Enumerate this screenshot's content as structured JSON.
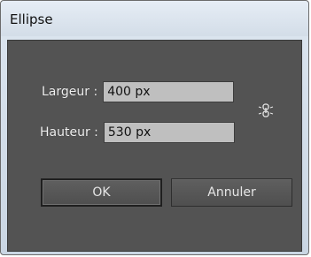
{
  "dialog": {
    "title": "Ellipse",
    "width_label": "Largeur :",
    "width_value": "400 px",
    "height_label": "Hauteur :",
    "height_value": "530 px",
    "constrain_icon": "chain-link-icon",
    "ok_label": "OK",
    "cancel_label": "Annuler"
  },
  "colors": {
    "panel_bg": "#535353",
    "field_bg": "#bfbfbf",
    "titlebar_bg": "#d3dde8"
  }
}
